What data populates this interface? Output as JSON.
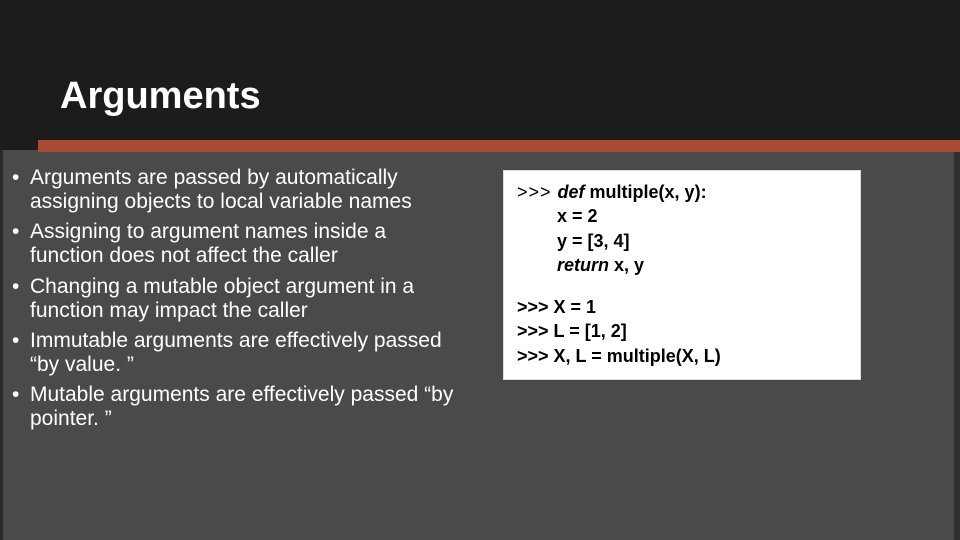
{
  "slide": {
    "title": "Arguments",
    "bullets": [
      "Arguments are passed by automatically assigning objects to local variable names",
      "Assigning to argument names inside a function does not affect the caller",
      "Changing a mutable object argument in a function may impact the caller",
      "Immutable arguments are effectively passed “by value. ”",
      "Mutable arguments are effectively passed “by pointer. ”"
    ],
    "code": {
      "l1_prompt": ">>> ",
      "l1_kw": "def",
      "l1_rest": " multiple(x, y):",
      "l2": "        x = 2",
      "l3": "        y = [3, 4]",
      "l4_kw": "        return",
      "l4_rest": " x, y",
      "l5": ">>> X = 1",
      "l6": ">>> L = [1, 2]",
      "l7": ">>> X, L = multiple(X, L)"
    }
  }
}
